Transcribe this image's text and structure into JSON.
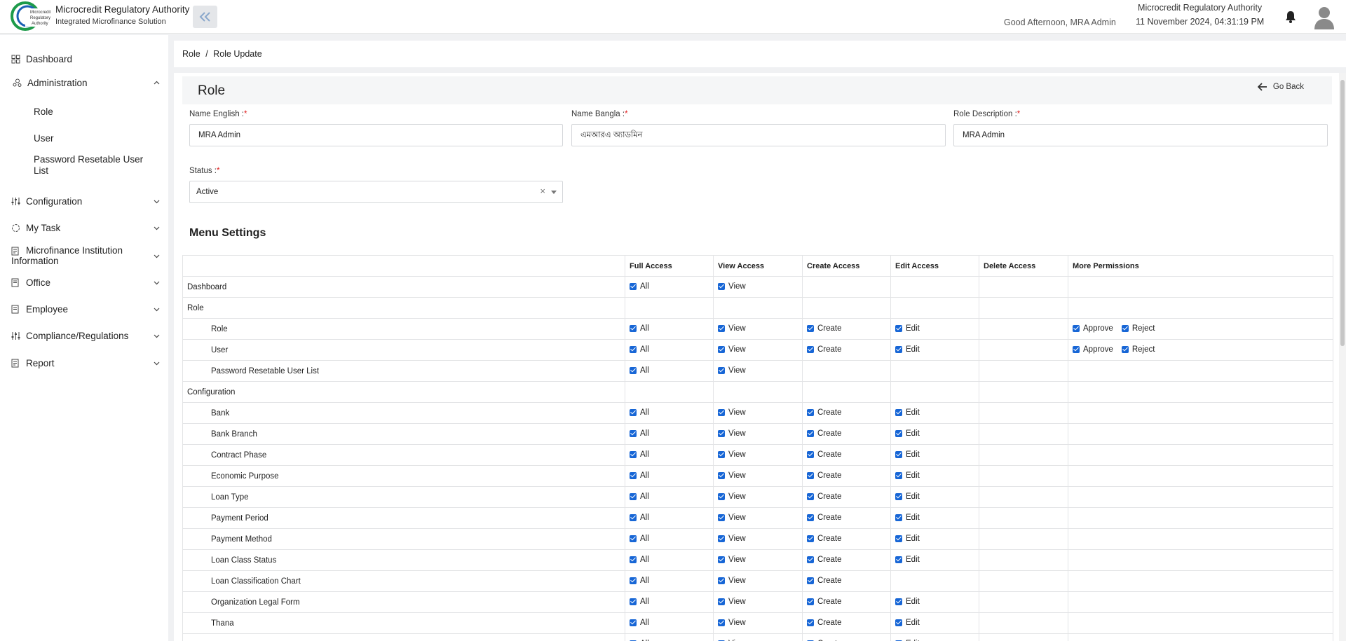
{
  "header": {
    "brand_title": "Microcredit Regulatory Authority",
    "brand_subtitle": "Integrated Microfinance Solution",
    "logo_text": "Microcredit Regulatory Authority",
    "greeting": "Good Afternoon, MRA Admin",
    "org_name": "Microcredit Regulatory Authority",
    "datetime": "11 November 2024, 04:31:19 PM"
  },
  "sidebar": {
    "items": [
      {
        "label": "Dashboard"
      },
      {
        "label": "Administration"
      },
      {
        "label": "Configuration"
      },
      {
        "label": "My Task"
      },
      {
        "label": "Microfinance Institution Information"
      },
      {
        "label": "Office"
      },
      {
        "label": "Employee"
      },
      {
        "label": "Compliance/Regulations"
      },
      {
        "label": "Report"
      }
    ],
    "admin_sub": [
      {
        "label": "Role"
      },
      {
        "label": "User"
      },
      {
        "label": "Password Resetable User List"
      }
    ]
  },
  "breadcrumb": {
    "parent": "Role",
    "separator": "/",
    "current": "Role Update"
  },
  "form": {
    "title": "Role",
    "go_back": "Go Back",
    "name_english_label": "Name English :",
    "name_english_value": "MRA Admin",
    "name_bangla_label": "Name Bangla :",
    "name_bangla_value": "এমআরএ অ্যাডমিন",
    "role_desc_label": "Role Description :",
    "role_desc_value": "MRA Admin",
    "status_label": "Status :",
    "status_value": "Active",
    "required_mark": "*",
    "clear_symbol": "×"
  },
  "menu_settings": {
    "title": "Menu Settings",
    "columns": [
      "",
      "Full Access",
      "View Access",
      "Create Access",
      "Edit Access",
      "Delete Access",
      "More Permissions"
    ],
    "rows": [
      {
        "name": "Dashboard",
        "level": 0,
        "full": "All",
        "view": "View",
        "create": "",
        "edit": "",
        "delete": "",
        "more": []
      },
      {
        "name": "Role",
        "level": 0,
        "full": "",
        "view": "",
        "create": "",
        "edit": "",
        "delete": "",
        "more": []
      },
      {
        "name": "Role",
        "level": 1,
        "full": "All",
        "view": "View",
        "create": "Create",
        "edit": "Edit",
        "delete": "",
        "more": [
          "Approve",
          "Reject"
        ]
      },
      {
        "name": "User",
        "level": 1,
        "full": "All",
        "view": "View",
        "create": "Create",
        "edit": "Edit",
        "delete": "",
        "more": [
          "Approve",
          "Reject"
        ]
      },
      {
        "name": "Password Resetable User List",
        "level": 1,
        "full": "All",
        "view": "View",
        "create": "",
        "edit": "",
        "delete": "",
        "more": []
      },
      {
        "name": "Configuration",
        "level": 0,
        "full": "",
        "view": "",
        "create": "",
        "edit": "",
        "delete": "",
        "more": []
      },
      {
        "name": "Bank",
        "level": 1,
        "full": "All",
        "view": "View",
        "create": "Create",
        "edit": "Edit",
        "delete": "",
        "more": []
      },
      {
        "name": "Bank Branch",
        "level": 1,
        "full": "All",
        "view": "View",
        "create": "Create",
        "edit": "Edit",
        "delete": "",
        "more": []
      },
      {
        "name": "Contract Phase",
        "level": 1,
        "full": "All",
        "view": "View",
        "create": "Create",
        "edit": "Edit",
        "delete": "",
        "more": []
      },
      {
        "name": "Economic Purpose",
        "level": 1,
        "full": "All",
        "view": "View",
        "create": "Create",
        "edit": "Edit",
        "delete": "",
        "more": []
      },
      {
        "name": "Loan Type",
        "level": 1,
        "full": "All",
        "view": "View",
        "create": "Create",
        "edit": "Edit",
        "delete": "",
        "more": []
      },
      {
        "name": "Payment Period",
        "level": 1,
        "full": "All",
        "view": "View",
        "create": "Create",
        "edit": "Edit",
        "delete": "",
        "more": []
      },
      {
        "name": "Payment Method",
        "level": 1,
        "full": "All",
        "view": "View",
        "create": "Create",
        "edit": "Edit",
        "delete": "",
        "more": []
      },
      {
        "name": "Loan Class Status",
        "level": 1,
        "full": "All",
        "view": "View",
        "create": "Create",
        "edit": "Edit",
        "delete": "",
        "more": []
      },
      {
        "name": "Loan Classification Chart",
        "level": 1,
        "full": "All",
        "view": "View",
        "create": "Create",
        "edit": "",
        "delete": "",
        "more": []
      },
      {
        "name": "Organization Legal Form",
        "level": 1,
        "full": "All",
        "view": "View",
        "create": "Create",
        "edit": "Edit",
        "delete": "",
        "more": []
      },
      {
        "name": "Thana",
        "level": 1,
        "full": "All",
        "view": "View",
        "create": "Create",
        "edit": "Edit",
        "delete": "",
        "more": []
      },
      {
        "name": "",
        "level": 1,
        "full": "All",
        "view": "View",
        "create": "Create",
        "edit": "Edit",
        "delete": "",
        "more": []
      }
    ]
  },
  "colors": {
    "accent": "#1766d6",
    "logo_green": "#1d9a4a",
    "logo_blue": "#1a5fb4",
    "required": "#e02020"
  }
}
